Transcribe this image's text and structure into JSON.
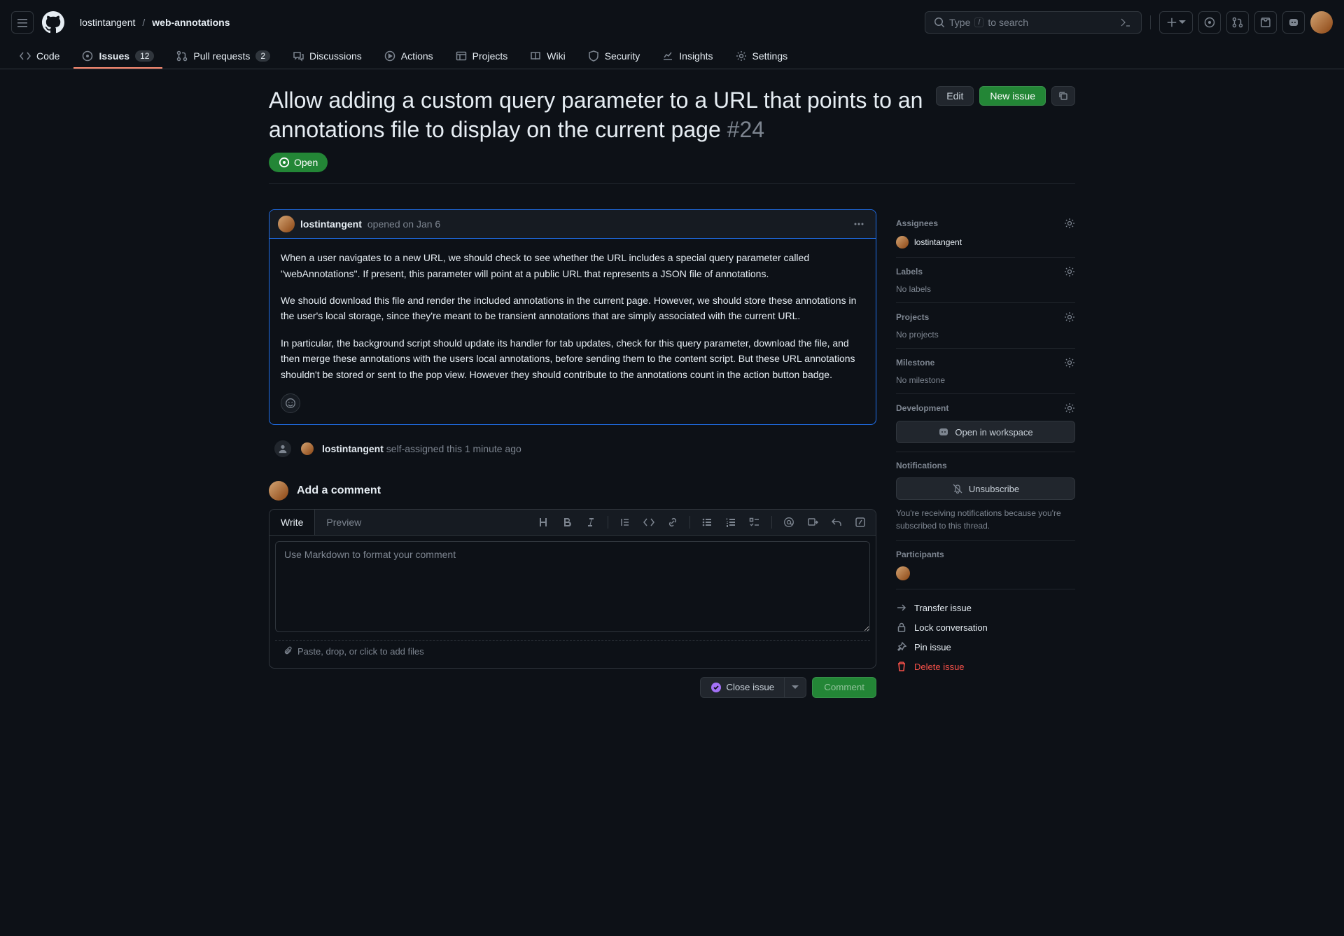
{
  "header": {
    "owner": "lostintangent",
    "sep": "/",
    "repo": "web-annotations",
    "search_prefix": "Type",
    "search_kbd": "/",
    "search_suffix": "to search"
  },
  "nav": {
    "code": "Code",
    "issues": "Issues",
    "issues_count": "12",
    "prs": "Pull requests",
    "prs_count": "2",
    "discussions": "Discussions",
    "actions": "Actions",
    "projects": "Projects",
    "wiki": "Wiki",
    "security": "Security",
    "insights": "Insights",
    "settings": "Settings"
  },
  "issue": {
    "title": "Allow adding a custom query parameter to a URL that points to an annotations file to display on the current page",
    "number": "#24",
    "edit": "Edit",
    "new_issue": "New issue",
    "status": "Open"
  },
  "comment": {
    "author": "lostintangent",
    "opened": "opened",
    "date": "on Jan 6",
    "p1": "When a user navigates to a new URL, we should check to see whether the URL includes a special query parameter called \"webAnnotations\". If present, this parameter will point at a public URL that represents a JSON file of annotations.",
    "p2": "We should download this file and render the included annotations in the current page. However, we should store these annotations in the user's local storage, since they're meant to be transient annotations that are simply associated with the current URL.",
    "p3": "In particular, the background script should update its handler for tab updates, check for this query parameter, download the file, and then merge these annotations with the users local annotations, before sending them to the content script. But these URL annotations shouldn't be stored or sent to the pop view. However they should contribute to the annotations count in the action button badge."
  },
  "timeline": {
    "author": "lostintangent",
    "action": "self-assigned this",
    "time": "1 minute ago"
  },
  "editor": {
    "add_title": "Add a comment",
    "write": "Write",
    "preview": "Preview",
    "placeholder": "Use Markdown to format your comment",
    "attach": "Paste, drop, or click to add files",
    "close_issue": "Close issue",
    "comment": "Comment"
  },
  "sidebar": {
    "assignees": {
      "title": "Assignees",
      "user": "lostintangent"
    },
    "labels": {
      "title": "Labels",
      "empty": "No labels"
    },
    "projects": {
      "title": "Projects",
      "empty": "No projects"
    },
    "milestone": {
      "title": "Milestone",
      "empty": "No milestone"
    },
    "development": {
      "title": "Development",
      "button": "Open in workspace"
    },
    "notifications": {
      "title": "Notifications",
      "button": "Unsubscribe",
      "note": "You're receiving notifications because you're subscribed to this thread."
    },
    "participants": {
      "title": "Participants"
    },
    "actions": {
      "transfer": "Transfer issue",
      "lock": "Lock conversation",
      "pin": "Pin issue",
      "delete": "Delete issue"
    }
  }
}
